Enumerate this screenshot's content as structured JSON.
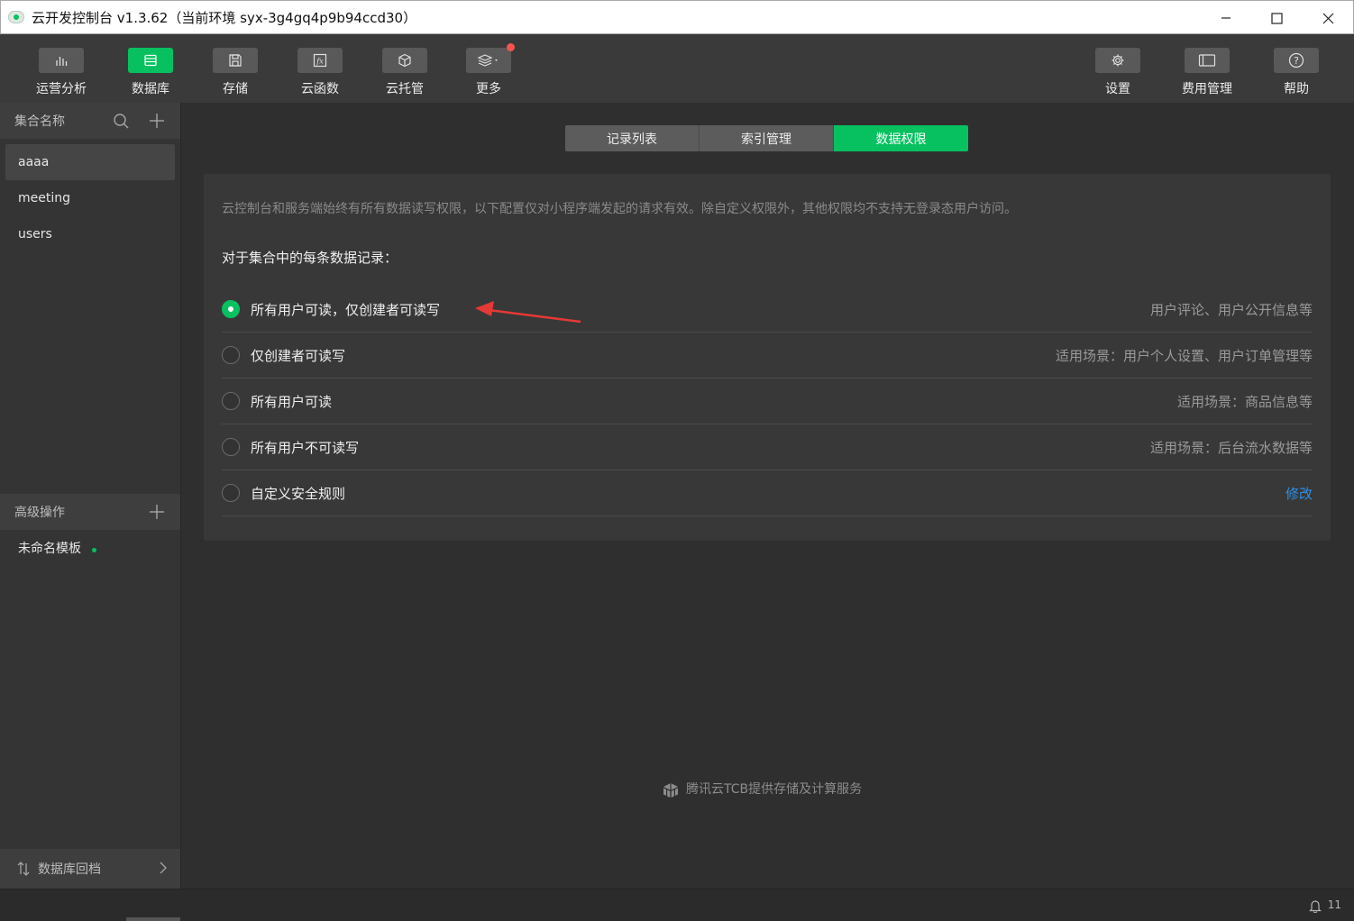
{
  "window": {
    "title": "云开发控制台 v1.3.62（当前环境 syx-3g4gq4p9b94ccd30）",
    "controls": [
      "minimize",
      "maximize",
      "close"
    ]
  },
  "toolbar": {
    "left": [
      {
        "label": "运营分析",
        "icon": "bar-chart-icon"
      },
      {
        "label": "数据库",
        "icon": "database-icon",
        "active": true
      },
      {
        "label": "存储",
        "icon": "floppy-icon"
      },
      {
        "label": "云函数",
        "icon": "function-icon"
      },
      {
        "label": "云托管",
        "icon": "cube-icon"
      },
      {
        "label": "更多",
        "icon": "layers-icon",
        "has_notification": true
      }
    ],
    "right": [
      {
        "label": "设置",
        "icon": "gear-icon"
      },
      {
        "label": "费用管理",
        "icon": "billing-icon"
      },
      {
        "label": "帮助",
        "icon": "help-icon"
      }
    ]
  },
  "sidebar": {
    "collections_header": "集合名称",
    "collections": [
      "aaaa",
      "meeting",
      "users"
    ],
    "selected_collection": "aaaa",
    "advanced_header": "高级操作",
    "template_name": "未命名模板",
    "rollback_label": "数据库回档"
  },
  "tabs": [
    {
      "label": "记录列表"
    },
    {
      "label": "索引管理"
    },
    {
      "label": "数据权限",
      "active": true
    }
  ],
  "permissions": {
    "notice": "云控制台和服务端始终有所有数据读写权限，以下配置仅对小程序端发起的请求有效。除自定义权限外，其他权限均不支持无登录态用户访问。",
    "subtitle": "对于集合中的每条数据记录：",
    "options": [
      {
        "label": "所有用户可读，仅创建者可读写",
        "desc": "用户评论、用户公开信息等",
        "selected": true
      },
      {
        "label": "仅创建者可读写",
        "desc": "适用场景：用户个人设置、用户订单管理等",
        "selected": false
      },
      {
        "label": "所有用户可读",
        "desc": "适用场景：商品信息等",
        "selected": false
      },
      {
        "label": "所有用户不可读写",
        "desc": "适用场景：后台流水数据等",
        "selected": false
      },
      {
        "label": "自定义安全规则",
        "link": "修改",
        "selected": false
      }
    ]
  },
  "footer": {
    "brand_text": "腾讯云TCB提供存储及计算服务"
  },
  "statusbar": {
    "notification_count": "11"
  },
  "colors": {
    "accent": "#07c160",
    "link": "#2f8fe8",
    "annotation_arrow": "#e53935"
  }
}
